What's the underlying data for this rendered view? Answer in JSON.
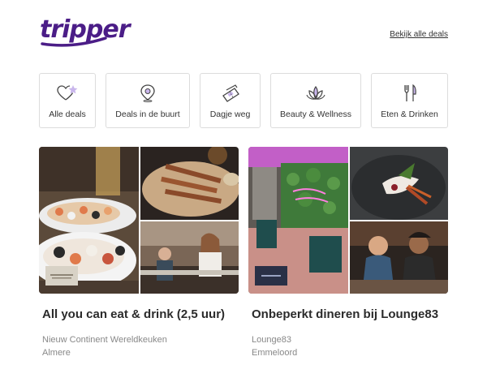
{
  "brand": {
    "logo_text": "tripper",
    "color": "#4b1d87"
  },
  "header": {
    "all_deals_link": "Bekijk alle deals"
  },
  "categories": [
    {
      "label": "Alle deals",
      "icon": "heart-star-icon"
    },
    {
      "label": "Deals in de buurt",
      "icon": "location-pin-icon"
    },
    {
      "label": "Dagje weg",
      "icon": "ticket-icon"
    },
    {
      "label": "Beauty & Wellness",
      "icon": "lotus-icon"
    },
    {
      "label": "Eten & Drinken",
      "icon": "fork-knife-icon"
    }
  ],
  "deals": [
    {
      "title": "All you can eat & drink (2,5 uur)",
      "vendor": "Nieuw Continent Wereldkeuken",
      "city": "Almere"
    },
    {
      "title": "Onbeperkt dineren bij Lounge83",
      "vendor": "Lounge83",
      "city": "Emmeloord"
    }
  ]
}
